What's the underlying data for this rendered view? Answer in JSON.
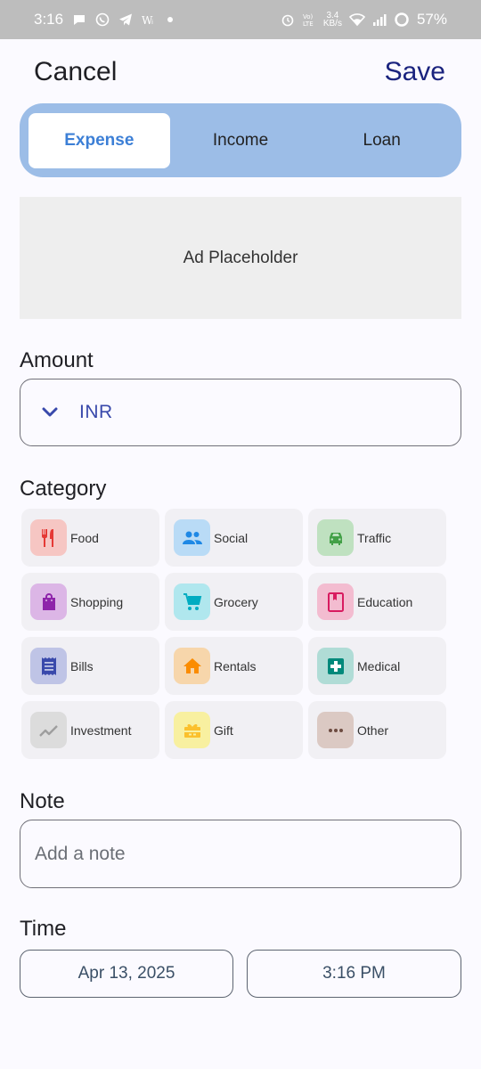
{
  "status_bar": {
    "time": "3:16",
    "battery": "57%",
    "net_speed_value": "3.4",
    "net_speed_unit": "KB/s"
  },
  "header": {
    "cancel_label": "Cancel",
    "save_label": "Save"
  },
  "tabs": [
    {
      "label": "Expense",
      "active": true
    },
    {
      "label": "Income",
      "active": false
    },
    {
      "label": "Loan",
      "active": false
    }
  ],
  "ad": {
    "label": "Ad Placeholder"
  },
  "amount": {
    "label": "Amount",
    "currency": "INR"
  },
  "category": {
    "label": "Category",
    "items": [
      {
        "label": "Food",
        "icon": "food-icon",
        "color": "#e53935",
        "bg": "#f6c6c3"
      },
      {
        "label": "Social",
        "icon": "social-icon",
        "color": "#1e88e5",
        "bg": "#b9dbf6"
      },
      {
        "label": "Traffic",
        "icon": "traffic-icon",
        "color": "#43a047",
        "bg": "#bfe1c0"
      },
      {
        "label": "Shopping",
        "icon": "shopping-icon",
        "color": "#8e24aa",
        "bg": "#dcb6e6"
      },
      {
        "label": "Grocery",
        "icon": "grocery-icon",
        "color": "#00acc1",
        "bg": "#b0e7ee"
      },
      {
        "label": "Education",
        "icon": "education-icon",
        "color": "#d81b60",
        "bg": "#f3bcd0"
      },
      {
        "label": "Bills",
        "icon": "bills-icon",
        "color": "#3949ab",
        "bg": "#bfc4e6"
      },
      {
        "label": "Rentals",
        "icon": "rentals-icon",
        "color": "#fb8c00",
        "bg": "#f7d6ab"
      },
      {
        "label": "Medical",
        "icon": "medical-icon",
        "color": "#00897b",
        "bg": "#b0dcd6"
      },
      {
        "label": "Investment",
        "icon": "investment-icon",
        "color": "#9e9e9e",
        "bg": "#dcdcdc"
      },
      {
        "label": "Gift",
        "icon": "gift-icon",
        "color": "#fbc02d",
        "bg": "#f8f0a0"
      },
      {
        "label": "Other",
        "icon": "other-icon",
        "color": "#6d4c41",
        "bg": "#dbc9c3"
      }
    ]
  },
  "note": {
    "label": "Note",
    "placeholder": "Add a note"
  },
  "time": {
    "label": "Time",
    "date": "Apr 13, 2025",
    "clock": "3:16 PM"
  }
}
